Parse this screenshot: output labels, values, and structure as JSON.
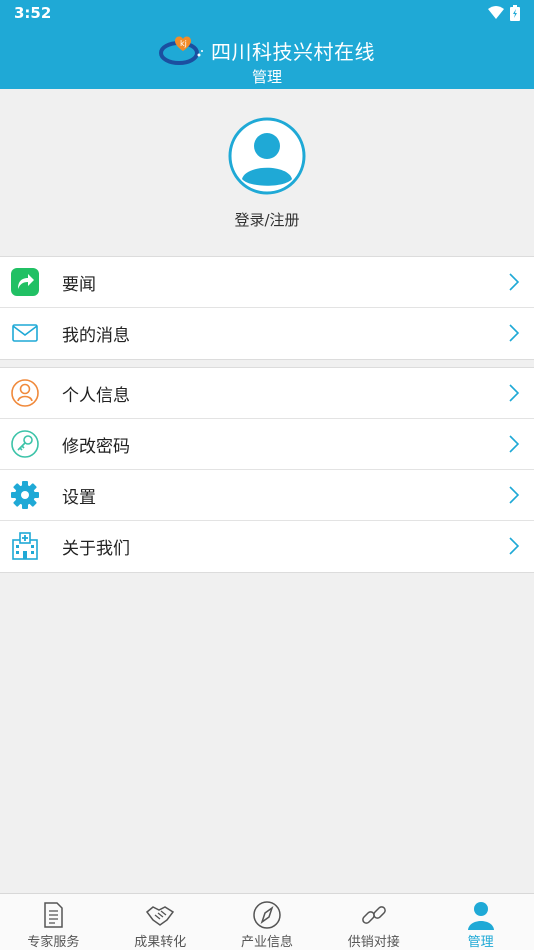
{
  "status_bar": {
    "time": "3:52"
  },
  "header": {
    "title": "四川科技兴村在线",
    "subtitle": "管理"
  },
  "profile": {
    "login_label": "登录/注册"
  },
  "menu_group_1": [
    {
      "label": "要闻",
      "icon": "share-arrow-icon"
    },
    {
      "label": "我的消息",
      "icon": "envelope-icon"
    }
  ],
  "menu_group_2": [
    {
      "label": "个人信息",
      "icon": "user-circle-icon"
    },
    {
      "label": "修改密码",
      "icon": "key-icon"
    },
    {
      "label": "设置",
      "icon": "gear-icon"
    },
    {
      "label": "关于我们",
      "icon": "hospital-icon"
    }
  ],
  "bottom_nav": [
    {
      "label": "专家服务",
      "icon": "document-icon"
    },
    {
      "label": "成果转化",
      "icon": "handshake-icon"
    },
    {
      "label": "产业信息",
      "icon": "compass-icon"
    },
    {
      "label": "供销对接",
      "icon": "link-icon"
    },
    {
      "label": "管理",
      "icon": "user-icon",
      "active": true
    }
  ],
  "colors": {
    "primary": "#1fa9d6",
    "green": "#21c064",
    "orange": "#f08a3c",
    "teal": "#3cc3a8"
  }
}
